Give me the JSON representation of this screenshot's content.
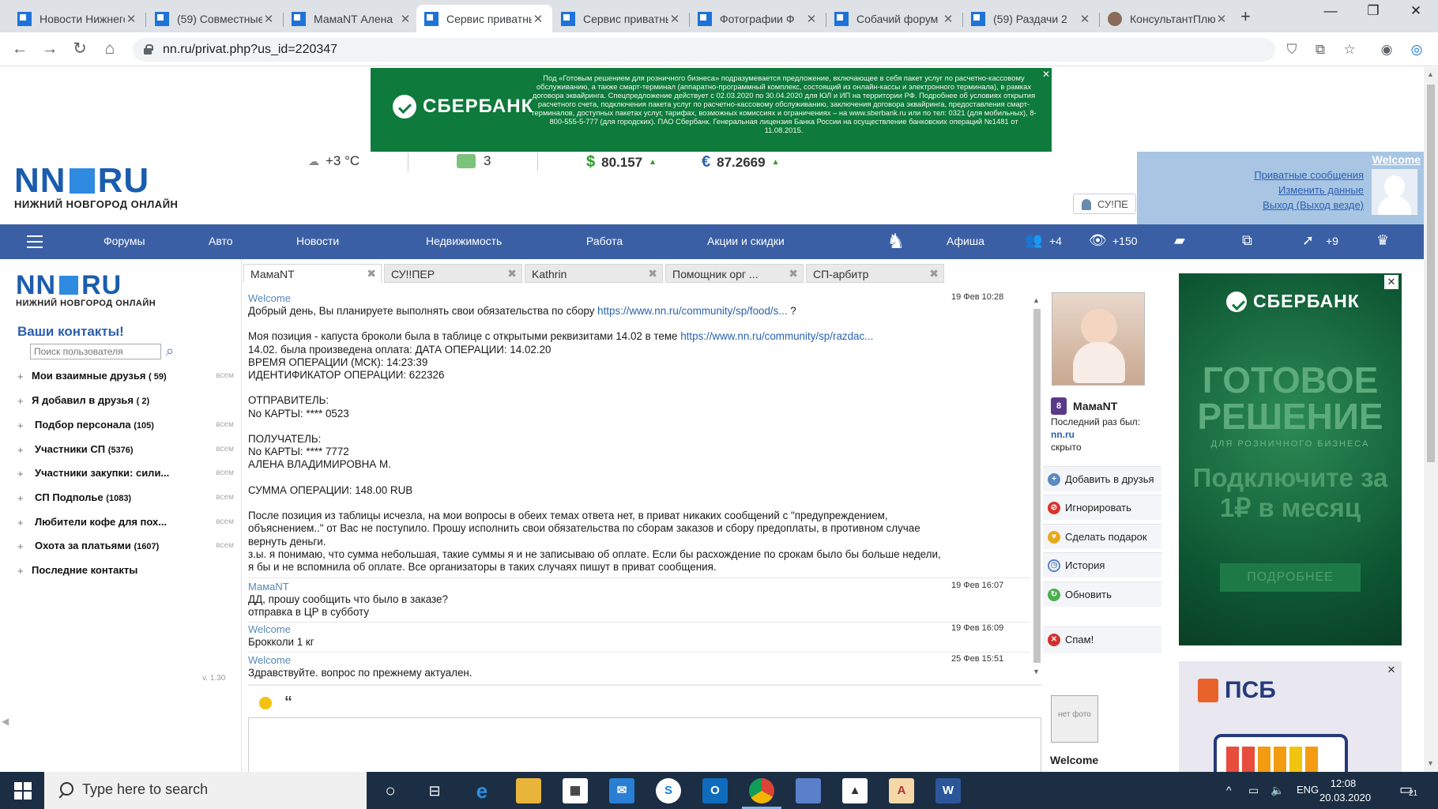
{
  "browser": {
    "tabs": [
      {
        "title": "Новости Нижнего",
        "active": false
      },
      {
        "title": "(59) Совместные",
        "active": false
      },
      {
        "title": "МамаNT Алена",
        "active": false
      },
      {
        "title": "Сервис приватных",
        "active": true
      },
      {
        "title": "Сервис приватных",
        "active": false
      },
      {
        "title": "Фотографии Ф",
        "active": false
      },
      {
        "title": "Собачий форум",
        "active": false
      },
      {
        "title": "(59) Раздачи 2",
        "active": false
      },
      {
        "title": "КонсультантПлюс",
        "active": false
      }
    ],
    "new_tab_glyph": "+",
    "url": "nn.ru/privat.php?us_id=220347"
  },
  "top_banner": {
    "logo_text": "СБЕРБАНК",
    "text": "Под «Готовым решением для розничного бизнеса» подразумевается предложение, включающее в себя пакет услуг по расчетно-кассовому обслуживанию, а также смарт-терминал (аппаратно-программный комплекс, состоящий из онлайн-кассы и электронного терминала), в рамках договора эквайринга. Спецпредложение действует с 02.03.2020 по 30.04.2020 для ЮЛ и ИП на территории РФ. Подробнее об условиях открытия расчетного счета, подключения пакета услуг по расчетно-кассовому обслуживанию, заключения договора эквайринга, предоставления смарт-терминалов, доступных пакетах услуг, тарифах, возможных комиссиях и ограничениях – на www.sberbank.ru или по тел: 0321 (для мобильных), 8-800-555-5-777 (для городских). ПАО Сбербанк. Генеральная лицензия Банка России на осуществление банковских операций №1481 от 11.08.2015.",
    "close": "✕"
  },
  "header": {
    "logo_main_left": "NN",
    "logo_main_right": "RU",
    "logo_sub": "НИЖНИЙ НОВГОРОД ОНЛАЙН",
    "weather": "+3 °C",
    "traffic": "3",
    "usd_symbol": "$",
    "usd": "80.157",
    "eur_symbol": "€",
    "eur": "87.2669",
    "user_chip": "СУ!ПЕ"
  },
  "welcome_box": {
    "title": "Welcome",
    "links": [
      "Приватные сообщения",
      "Изменить данные",
      "Выход (Выход везде)"
    ]
  },
  "nav": {
    "items": [
      "Форумы",
      "Авто",
      "Новости",
      "Недвижимость",
      "Работа",
      "Акции и скидки",
      "Афиша"
    ],
    "friends_count": "+4",
    "views_count": "+150",
    "rating_count": "+9"
  },
  "sidebar": {
    "title": "Ваши контакты!",
    "search_placeholder": "Поиск пользователя",
    "all_label": "всем",
    "groups": [
      {
        "name": "Мои взаимные друзья",
        "count": "( 59)",
        "all": true
      },
      {
        "name": "Я добавил в друзья",
        "count": "( 2)",
        "all": false
      },
      {
        "name": "Подбор персонала",
        "count": "(105)",
        "all": true
      },
      {
        "name": "Участники СП",
        "count": "(5376)",
        "all": true
      },
      {
        "name": "Участники закупки: сили...",
        "count": "",
        "all": true
      },
      {
        "name": "СП Подполье",
        "count": "(1083)",
        "all": true
      },
      {
        "name": "Любители кофе для пох...",
        "count": "",
        "all": true
      },
      {
        "name": "Охота за платьями",
        "count": "(1607)",
        "all": true
      },
      {
        "name": "Последние контакты",
        "count": "",
        "all": false
      }
    ],
    "version": "v. 1.30"
  },
  "chat_tabs": [
    "МамаNT",
    "СУ!!ПЕР",
    "Kathrin",
    "Помощник орг ...",
    "СП-арбитр"
  ],
  "messages": [
    {
      "author": "Welcome",
      "time": "19 Фев 10:28",
      "line1_pre": "Добрый день, Вы планируете выполнять свои обязательства по сбору ",
      "line1_link": "https://www.nn.ru/community/sp/food/s...",
      "line1_post": " ?",
      "line2_pre": "Моя позиция - капуста броколи была в таблице с открытыми реквизитами 14.02 в теме ",
      "line2_link": "https://www.nn.ru/community/sp/razdac...",
      "rest": "14.02. была произведена оплата: ДАТА ОПЕРАЦИИ: 14.02.20\nВРЕМЯ ОПЕРАЦИИ (МСК): 14:23:39\nИДЕНТИФИКАТОР ОПЕРАЦИИ: 622326\n\nОТПРАВИТЕЛЬ:\nNo КАРТЫ: **** 0523\n\nПОЛУЧАТЕЛЬ:\nNo КАРТЫ: **** 7772\nАЛЕНА ВЛАДИМИРОВНА М.\n\nСУММА ОПЕРАЦИИ: 148.00 RUB\n\nПосле позиция из таблицы исчезла, на мои вопросы в обеих темах ответа нет, в приват никаких сообщений с \"предупреждением, объяснением..\" от Вас не поступило. Прошу исполнить свои обязательства по сборам заказов и сбору предоплаты, в противном случае вернуть деньги.\nз.ы. я понимаю, что сумма небольшая, такие суммы я и не записываю об оплате. Если бы расхождение по срокам было бы больше недели, я бы и не вспомнила об оплате. Все организаторы в таких случаях пишут в приват сообщения."
    },
    {
      "author": "МамаNT",
      "time": "19 Фев 16:07",
      "text": "ДД, прошу сообщить что было в заказе?\nотправка в ЦР в субботу"
    },
    {
      "author": "Welcome",
      "time": "19 Фев 16:09",
      "text": "Брокколи 1 кг"
    },
    {
      "author": "Welcome",
      "time": "25 Фев 15:51",
      "text": "Здравствуйте. вопрос по прежнему актуален."
    }
  ],
  "profile": {
    "name": "МамаNT",
    "badge": "8",
    "last_seen_label": "Последний раз был:",
    "last_seen_site": "nn.ru",
    "last_seen_status": "скрыто",
    "actions": [
      "Добавить в друзья",
      "Игнорировать",
      "Сделать подарок",
      "История",
      "Обновить",
      "Спам!"
    ]
  },
  "composer": {
    "quote_glyph": "“",
    "my_photo_text": "нет фото",
    "my_name": "Welcome"
  },
  "ad_right1": {
    "logo": "СБЕРБАНК",
    "headline": "ГОТОВОЕ РЕШЕНИЕ",
    "subline": "ДЛЯ РОЗНИЧНОГО БИЗНЕСА",
    "offer": "Подключите за 1₽ в месяц",
    "button": "ПОДРОБНЕЕ"
  },
  "ad_right2": {
    "logo": "ПСБ"
  },
  "taskbar": {
    "search_placeholder": "Type here to search",
    "lang": "ENG",
    "time": "12:08",
    "date": "20.03.2020",
    "notifications": "21"
  },
  "colors": {
    "nav_blue": "#3a5fa4",
    "brand_blue": "#1b5cae",
    "sber_green": "#0e7a3b",
    "link": "#2a62b0"
  }
}
